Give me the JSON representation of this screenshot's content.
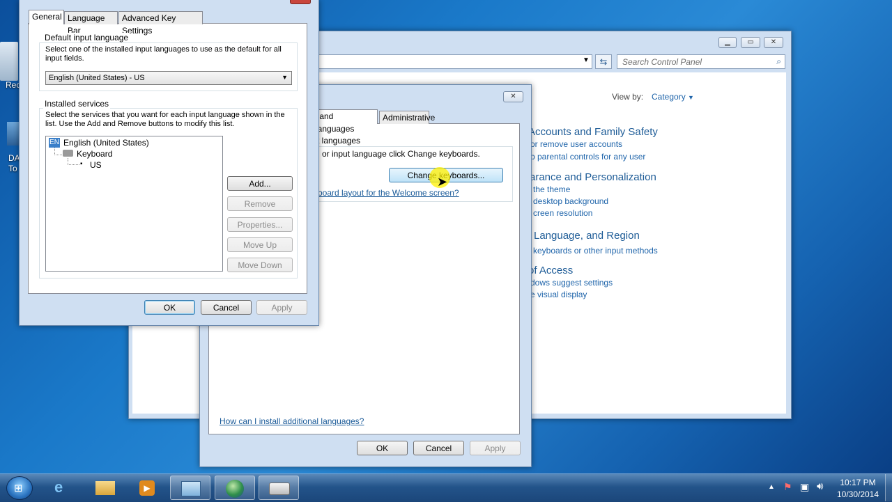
{
  "desktop": {
    "icon1_label": "Rec",
    "icon2_label1": "DA",
    "icon2_label2": "To"
  },
  "control_panel": {
    "search_placeholder": "Search Control Panel",
    "view_by_label": "View by:",
    "view_by_value": "Category",
    "sections": [
      {
        "title": "Accounts and Family Safety",
        "links": [
          "or remove user accounts",
          "p parental controls for any user"
        ]
      },
      {
        "title": "arance and Personalization",
        "links": [
          "the theme",
          "desktop background",
          "creen resolution"
        ]
      },
      {
        "title": "Language, and Region",
        "links": [
          "keyboards or other input methods"
        ]
      },
      {
        "title": "of Access",
        "links": [
          "dows suggest settings",
          "e visual display"
        ]
      }
    ]
  },
  "region_dialog": {
    "tabs": [
      "s and Languages",
      "Administrative"
    ],
    "group_label": "t languages",
    "description": "l or input language click Change keyboards.",
    "change_keyboards_button": "Change keyboards...",
    "welcome_link": "board layout for the Welcome screen?",
    "install_link": "How can I install additional languages?",
    "ok": "OK",
    "cancel": "Cancel",
    "apply": "Apply"
  },
  "text_services_dialog": {
    "tabs": [
      "General",
      "Language Bar",
      "Advanced Key Settings"
    ],
    "default_group": "Default input language",
    "default_desc": "Select one of the installed input languages to use as the default for all input fields.",
    "default_value": "English (United States) - US",
    "installed_group": "Installed services",
    "installed_desc": "Select the services that you want for each input language shown in the list. Use the Add and Remove buttons to modify this list.",
    "tree": {
      "lang_badge": "EN",
      "language": "English (United States)",
      "category": "Keyboard",
      "layout": "US"
    },
    "buttons": {
      "add": "Add...",
      "remove": "Remove",
      "properties": "Properties...",
      "move_up": "Move Up",
      "move_down": "Move Down"
    },
    "ok": "OK",
    "cancel": "Cancel",
    "apply": "Apply"
  },
  "taskbar": {
    "time": "10:17 PM",
    "date": "10/30/2014"
  }
}
